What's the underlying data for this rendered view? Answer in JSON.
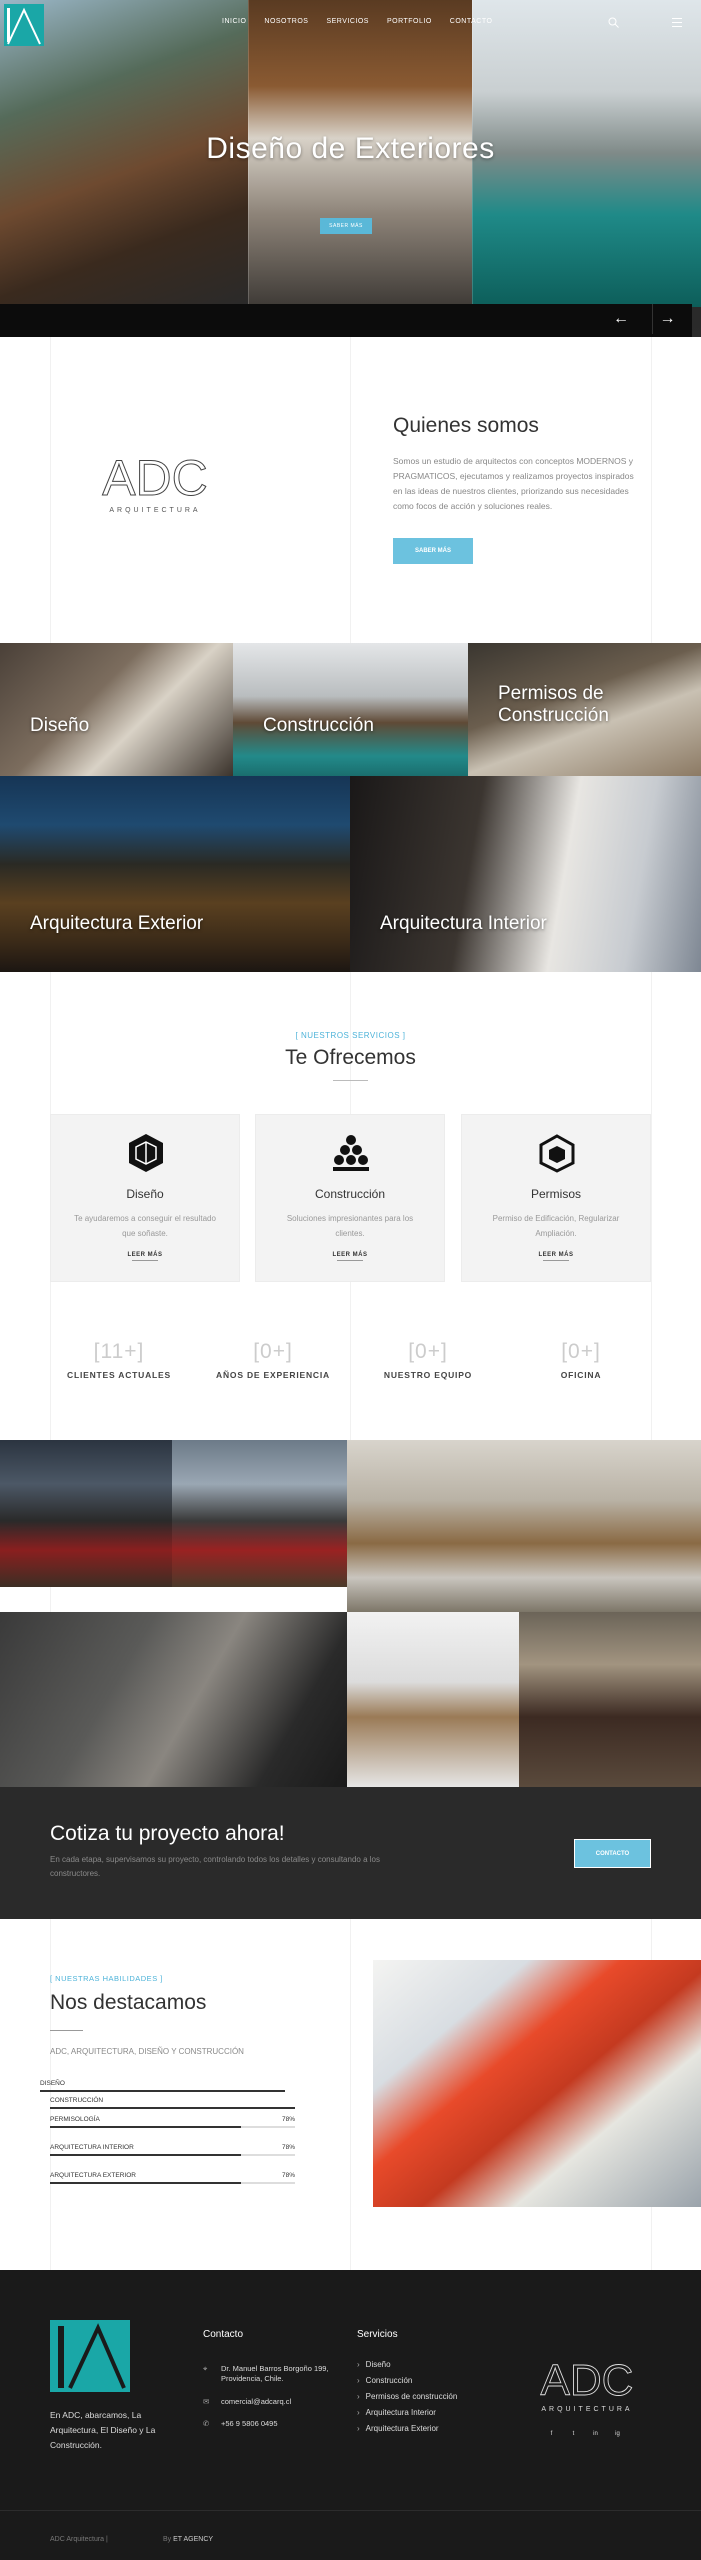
{
  "nav": {
    "items": [
      "INICIO",
      "NOSOTROS",
      "SERVICIOS",
      "PORTFOLIO",
      "CONTACTO"
    ]
  },
  "hero": {
    "title": "Diseño de Exteriores",
    "button": "SABER MÁS"
  },
  "about": {
    "logo_text": "ADC",
    "logo_sub": "ARQUITECTURA",
    "title": "Quienes somos",
    "text": "Somos un estudio de arquitectos con conceptos MODERNOS y PRAGMATICOS, ejecutamos y realizamos proyectos inspirados en las ideas de nuestros clientes, priorizando sus necesidades como focos de acción y soluciones reales.",
    "button": "SABER MÁS"
  },
  "categories": [
    "Diseño",
    "Construcción",
    "Permisos de Construcción",
    "Arquitectura Exterior",
    "Arquitectura Interior"
  ],
  "services": {
    "tag": "[ NUESTROS SERVICIOS ]",
    "title": "Te Ofrecemos",
    "cards": [
      {
        "title": "Diseño",
        "desc": "Te ayudaremos a conseguir el resultado que soñaste.",
        "more": "LEER MÁS"
      },
      {
        "title": "Construcción",
        "desc": "Soluciones impresionantes para los clientes.",
        "more": "LEER MÁS"
      },
      {
        "title": "Permisos",
        "desc": "Permiso de Edificación, Regularizar Ampliación.",
        "more": "LEER MÁS"
      }
    ]
  },
  "counters": [
    {
      "value": "[11+]",
      "label": "CLIENTES ACTUALES"
    },
    {
      "value": "[0+]",
      "label": "AÑOS DE EXPERIENCIA"
    },
    {
      "value": "[0+]",
      "label": "NUESTRO EQUIPO"
    },
    {
      "value": "[0+]",
      "label": "OFICINA"
    }
  ],
  "quote": {
    "title": "Cotiza tu proyecto ahora!",
    "text": "En cada etapa, supervisamos su proyecto, controlando todos los detalles y consultando a los constructores.",
    "button": "CONTACTO"
  },
  "skills": {
    "tag": "[ NUESTRAS HABILIDADES ]",
    "title": "Nos destacamos",
    "sub": "ADC, ARQUITECTURA, DISEÑO Y CONSTRUCCIÓN",
    "items": [
      {
        "label": "DISEÑO",
        "pct": "",
        "value": 1.0
      },
      {
        "label": "CONSTRUCCIÓN",
        "pct": "",
        "value": 1.0
      },
      {
        "label": "PERMISOLOGÍA",
        "pct": "78%",
        "value": 0.78
      },
      {
        "label": "ARQUITECTURA INTERIOR",
        "pct": "78%",
        "value": 0.78
      },
      {
        "label": "ARQUITECTURA EXTERIOR",
        "pct": "78%",
        "value": 0.78
      }
    ]
  },
  "footer": {
    "about": "En ADC, abarcamos, La Arquitectura, El Diseño y La Construcción.",
    "contact_title": "Contacto",
    "address": "Dr. Manuel Barros Borgoño 199, Providencia, Chile.",
    "email": "comercial@adcarq.cl",
    "phone": "+56 9 5806 0495",
    "services_title": "Servicios",
    "services": [
      "Diseño",
      "Construcción",
      "Permisos de construcción",
      "Arquitectura Interior",
      "Arquitectura Exterior"
    ],
    "logo_text": "ADC",
    "logo_sub": "ARQUITECTURA",
    "social": [
      "f",
      "t",
      "in",
      "ig"
    ],
    "copyright": "ADC Arquitectura |",
    "by_prefix": "By",
    "by_agency": "ET AGENCY"
  },
  "colors": {
    "accent": "#5ab8d8",
    "dark": "#1a1a1a"
  }
}
